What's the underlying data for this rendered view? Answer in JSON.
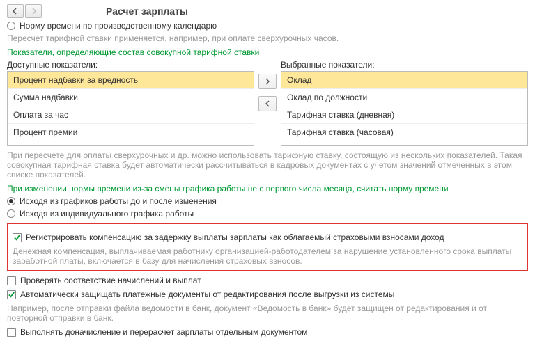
{
  "title": "Расчет зарплаты",
  "radio_norm_calendar": "Норму времени по производственному календарю",
  "note_recalc": "Пересчет тарифной ставки применяется, например, при оплате сверхурочных часов.",
  "green_aggregate": "Показатели, определяющие состав совокупной тарифной ставки",
  "available_label": "Доступные показатели:",
  "selected_label": "Выбранные показатели:",
  "available": {
    "i0": "Процент надбавки за вредность",
    "i1": "Сумма надбавки",
    "i2": "Оплата за час",
    "i3": "Процент премии"
  },
  "selected": {
    "i0": "Оклад",
    "i1": "Оклад по должности",
    "i2": "Тарифная ставка (дневная)",
    "i3": "Тарифная ставка (часовая)"
  },
  "note_overtime": "При пересчете для оплаты сверхурочных и др. можно использовать тарифную ставку, состоящую из нескольких показателей. Такая совокупная тарифная ставка будет автоматически рассчитываться в кадровых документах с учетом значений отмеченных в этом списке показателей.",
  "green_schedule": "При изменении нормы времени из-за смены графика работы не с первого числа месяца, считать норму времени",
  "radio_sched_a": "Исходя из графиков работы до и после изменения",
  "radio_sched_b": "Исходя из индивидуального графика работы",
  "chk_register": "Регистрировать компенсацию за задержку выплаты зарплаты как облагаемый страховыми взносами доход",
  "note_register": "Денежная компенсация, выплачиваемая работнику организацией-работодателем за нарушение установленного срока выплаты заработной платы, включается в базу для начисления страховых взносов.",
  "chk_verify": "Проверять соответствие начислений и выплат",
  "chk_protect": "Автоматически защищать платежные документы от редактирования после выгрузки из системы",
  "note_protect": "Например, после отправки файла ведомости в банк, документ «Ведомость в банк» будет защищен от редактирования и от повторной отправки в банк.",
  "chk_separate": "Выполнять доначисление и перерасчет зарплаты отдельным документом",
  "chart_data": null
}
